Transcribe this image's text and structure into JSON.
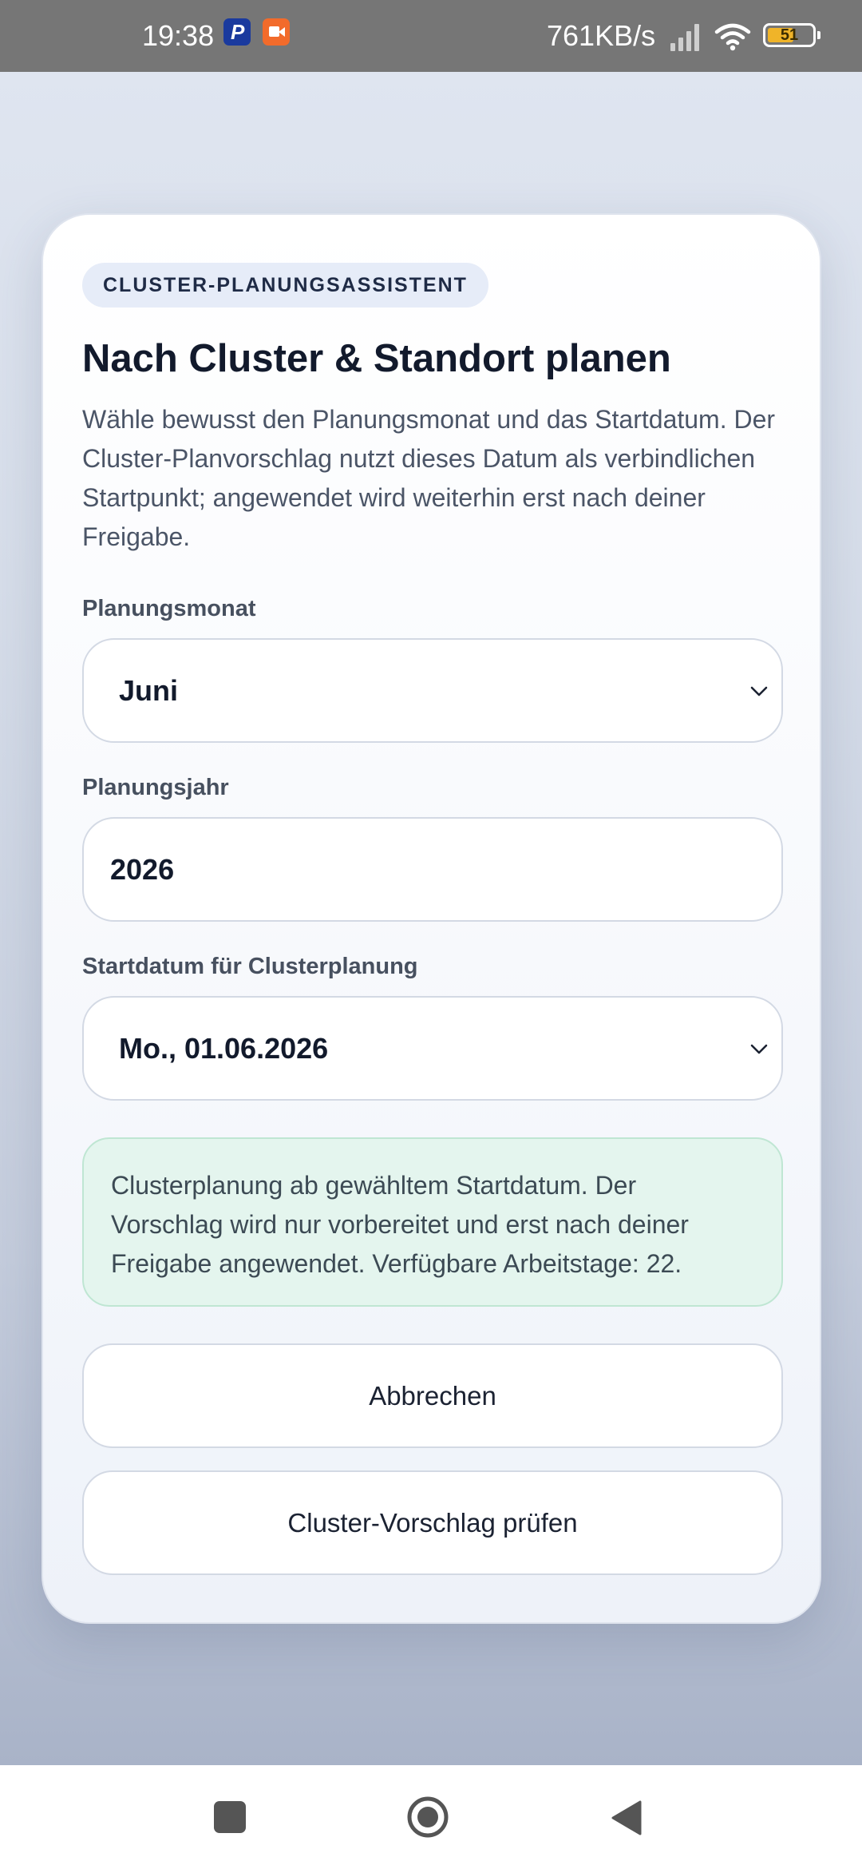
{
  "status_bar": {
    "time": "19:38",
    "speed": "761KB/s",
    "battery": "51",
    "icons": [
      "paypal-icon",
      "screen-record-icon",
      "signal-icon",
      "wifi-icon",
      "battery-icon"
    ]
  },
  "dialog": {
    "badge": "CLUSTER-PLANUNGSASSISTENT",
    "title": "Nach Cluster & Standort planen",
    "description": "Wähle bewusst den Planungsmonat und das Startdatum. Der Cluster-Planvorschlag nutzt dieses Datum als verbindlichen Startpunkt; angewendet wird weiterhin erst nach deiner Freigabe.",
    "month": {
      "label": "Planungsmonat",
      "value": "Juni"
    },
    "year": {
      "label": "Planungsjahr",
      "value": "2026"
    },
    "start_date": {
      "label": "Startdatum für Clusterplanung",
      "value": "Mo., 01.06.2026"
    },
    "info_text": "Clusterplanung ab gewähltem Startdatum. Der Vorschlag wird nur vorbereitet und erst nach deiner Freigabe angewendet. Verfügbare Arbeitstage: 22.",
    "cancel_label": "Abbrechen",
    "review_label": "Cluster-Vorschlag prüfen"
  },
  "colors": {
    "accent_badge_bg": "#e6ecf8",
    "info_bg": "#e4f5ee",
    "info_border": "#bfe6d3",
    "title_text": "#121a2c"
  },
  "nav_bar": {
    "icons": [
      "recents-icon",
      "home-icon",
      "back-icon"
    ]
  }
}
